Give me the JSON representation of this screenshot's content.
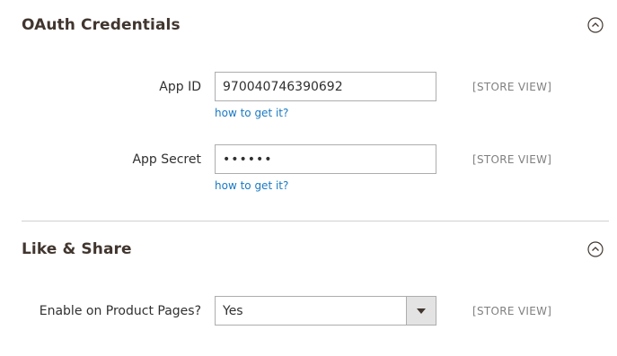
{
  "sections": {
    "oauth": {
      "title": "OAuth Credentials",
      "icon": "collapse-up-icon"
    },
    "like_share": {
      "title": "Like & Share",
      "icon": "collapse-up-icon"
    }
  },
  "fields": {
    "app_id": {
      "label": "App ID",
      "value": "970040746390692",
      "help": "how to get it?",
      "scope": "[STORE VIEW]"
    },
    "app_secret": {
      "label": "App Secret",
      "value": "••••••",
      "help": "how to get it?",
      "scope": "[STORE VIEW]"
    },
    "enable_product_pages": {
      "label": "Enable on Product Pages?",
      "value": "Yes",
      "scope": "[STORE VIEW]",
      "icon": "chevron-down-icon"
    }
  },
  "colors": {
    "link": "#1979c3",
    "scope_text": "#808080",
    "title": "#41362f",
    "border": "#adadad"
  }
}
